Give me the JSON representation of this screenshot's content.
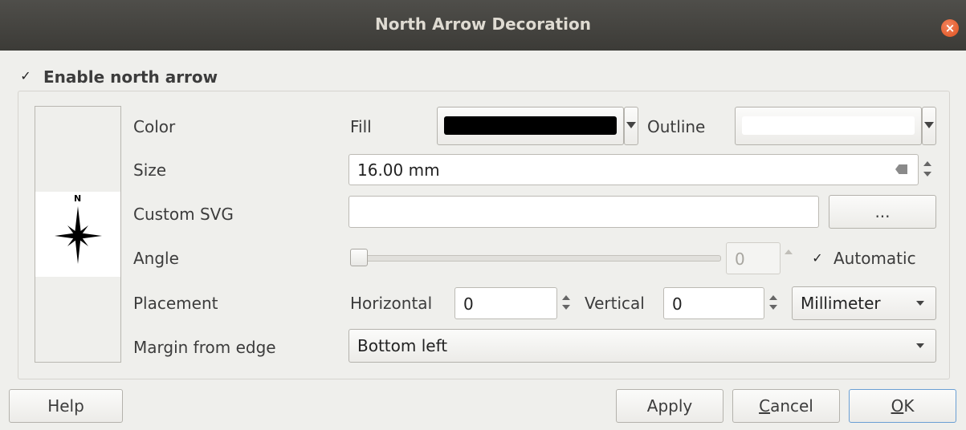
{
  "window": {
    "title": "North Arrow Decoration"
  },
  "enable": {
    "checked": true,
    "mark": "✓",
    "label": "Enable north arrow"
  },
  "preview": {
    "north_label": "N"
  },
  "color": {
    "label": "Color",
    "fill_label": "Fill",
    "fill_color": "#000000",
    "outline_label": "Outline",
    "outline_color": "#ffffff"
  },
  "size": {
    "label": "Size",
    "value": "16.00 mm"
  },
  "custom_svg": {
    "label": "Custom SVG",
    "value": "",
    "browse_label": "..."
  },
  "angle": {
    "label": "Angle",
    "value": "0",
    "automatic_checked": true,
    "automatic_mark": "✓",
    "automatic_label": "Automatic",
    "slider_fraction": 0
  },
  "placement": {
    "label": "Placement",
    "horizontal_label": "Horizontal",
    "horizontal_value": "0",
    "vertical_label": "Vertical",
    "vertical_value": "0",
    "unit": "Millimeter"
  },
  "margin": {
    "label": "Margin from edge",
    "value": "Bottom left"
  },
  "buttons": {
    "help": "Help",
    "apply": "Apply",
    "cancel_u": "C",
    "cancel_rest": "ancel",
    "ok_u": "O",
    "ok_rest": "K"
  }
}
